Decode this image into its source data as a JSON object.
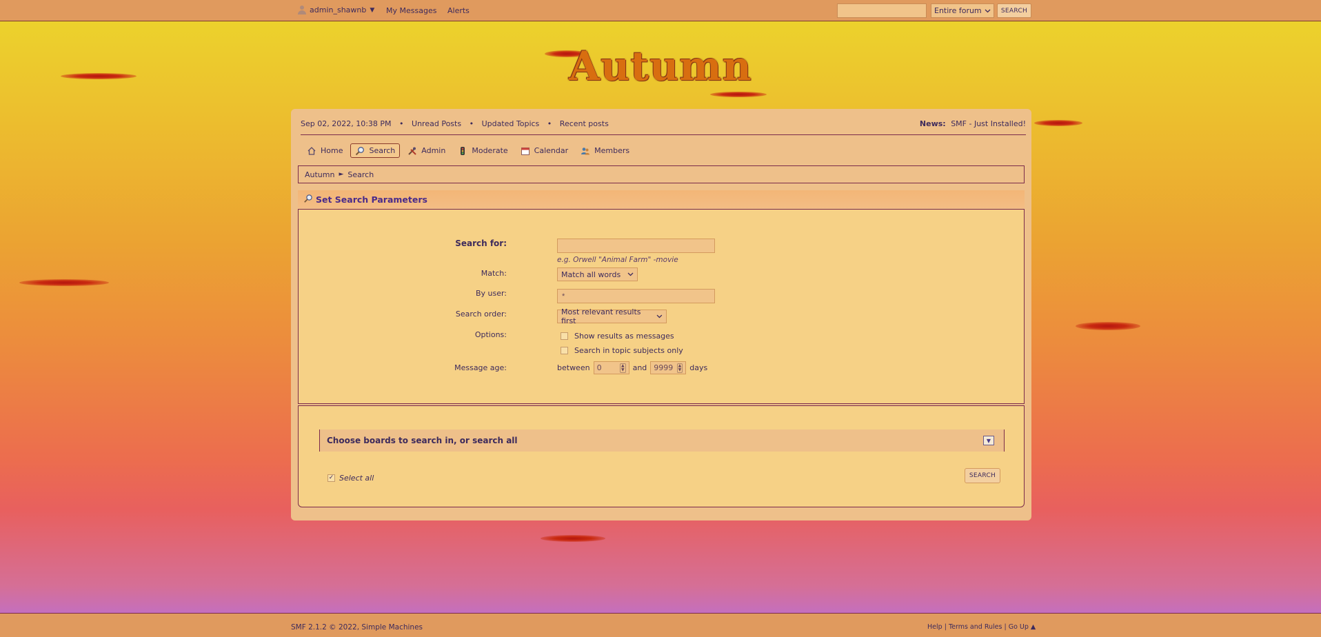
{
  "topbar": {
    "username": "admin_shawnb",
    "user_menu_arrow": "▼",
    "my_messages": "My Messages",
    "alerts": "Alerts",
    "search_placeholder": "",
    "scope_select": "Entire forum",
    "search_button": "SEARCH"
  },
  "logo": "Autumn",
  "upper_bar": {
    "datetime": "Sep 02, 2022, 10:38 PM",
    "links": [
      "Unread Posts",
      "Updated Topics",
      "Recent posts"
    ],
    "separator": "•",
    "news_label": "News:",
    "news_text": "SMF - Just Installed!"
  },
  "menu": {
    "home": "Home",
    "search": "Search",
    "admin": "Admin",
    "moderate": "Moderate",
    "calendar": "Calendar",
    "members": "Members"
  },
  "breadcrumb": {
    "root": "Autumn",
    "sep": "►",
    "current": "Search"
  },
  "search_form": {
    "header": "Set Search Parameters",
    "search_for_label": "Search for:",
    "search_for_value": "",
    "search_for_hint": "e.g. Orwell \"Animal Farm\" -movie",
    "match_label": "Match:",
    "match_value": "Match all words",
    "by_user_label": "By user:",
    "by_user_value": "*",
    "order_label": "Search order:",
    "order_value": "Most relevant results first",
    "options_label": "Options:",
    "option_show_messages": "Show results as messages",
    "option_subjects_only": "Search in topic subjects only",
    "age_label": "Message age:",
    "age_between": "between",
    "age_min": "0",
    "age_and": "and",
    "age_max": "9999",
    "age_days": "days"
  },
  "boards": {
    "header": "Choose boards to search in, or search all",
    "select_all": "Select all",
    "search_button": "SEARCH"
  },
  "footer": {
    "copyright": "SMF 2.1.2 © 2022, Simple Machines",
    "help": "Help",
    "terms": "Terms and Rules",
    "go_up": "Go Up ▲",
    "pipe": "|"
  }
}
